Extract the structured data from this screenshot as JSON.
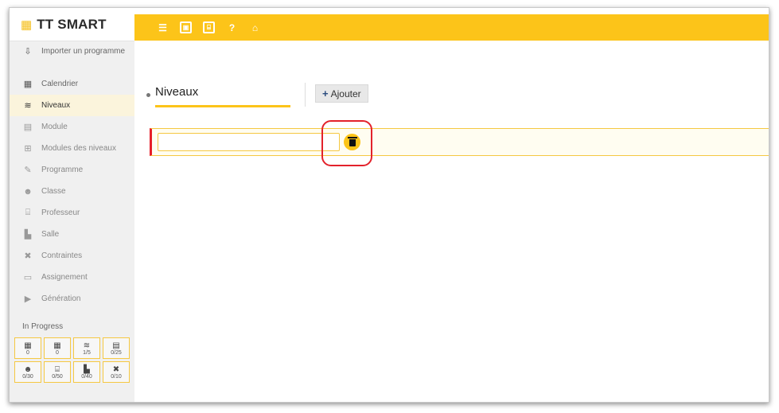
{
  "app": {
    "name": "TT SMART",
    "logo_icon": "calendar-icon",
    "accent_color": "#fcc419",
    "alert_color": "#e3222b"
  },
  "toolbar": {
    "buttons": [
      {
        "icon": "menu-icon",
        "glyph": "☰"
      },
      {
        "icon": "save-icon",
        "glyph": "▣"
      },
      {
        "icon": "teacher-board-icon",
        "glyph": "⌸"
      },
      {
        "icon": "help-icon",
        "glyph": "?"
      },
      {
        "icon": "home-icon",
        "glyph": "⌂"
      }
    ]
  },
  "sidebar": {
    "items": [
      {
        "label": "Importer un programme",
        "icon": "import-icon",
        "glyph": "⇩"
      },
      {
        "label": "Calendrier",
        "icon": "calendar-icon",
        "glyph": "▦"
      },
      {
        "label": "Niveaux",
        "icon": "layers-icon",
        "glyph": "≋",
        "active": true
      },
      {
        "label": "Module",
        "icon": "book-icon",
        "glyph": "▤"
      },
      {
        "label": "Modules des niveaux",
        "icon": "sitemap-icon",
        "glyph": "⊞"
      },
      {
        "label": "Programme",
        "icon": "ruler-icon",
        "glyph": "✎"
      },
      {
        "label": "Classe",
        "icon": "users-icon",
        "glyph": "☻"
      },
      {
        "label": "Professeur",
        "icon": "teacher-icon",
        "glyph": "⌸"
      },
      {
        "label": "Salle",
        "icon": "room-icon",
        "glyph": "▙"
      },
      {
        "label": "Contraintes",
        "icon": "tools-icon",
        "glyph": "✖"
      },
      {
        "label": "Assignement",
        "icon": "monitor-icon",
        "glyph": "▭"
      },
      {
        "label": "Génération",
        "icon": "play-icon",
        "glyph": "▶"
      }
    ],
    "progress_label": "In Progress",
    "progress": [
      {
        "icon": "calendar-icon",
        "glyph": "▦",
        "value": "0"
      },
      {
        "icon": "calendar-icon",
        "glyph": "▦",
        "value": "0"
      },
      {
        "icon": "layers-icon",
        "glyph": "≋",
        "value": "1/5"
      },
      {
        "icon": "book-icon",
        "glyph": "▤",
        "value": "0/25"
      },
      {
        "icon": "users-icon",
        "glyph": "☻",
        "value": "0/30"
      },
      {
        "icon": "teacher-icon",
        "glyph": "⌸",
        "value": "0/50"
      },
      {
        "icon": "room-icon",
        "glyph": "▙",
        "value": "0/40"
      },
      {
        "icon": "tools-icon",
        "glyph": "✖",
        "value": "0/10"
      }
    ]
  },
  "main": {
    "title": "Niveaux",
    "add_button": {
      "plus": "+",
      "label": "Ajouter"
    },
    "level_row": {
      "value": "",
      "delete_icon": "trash-icon"
    }
  }
}
